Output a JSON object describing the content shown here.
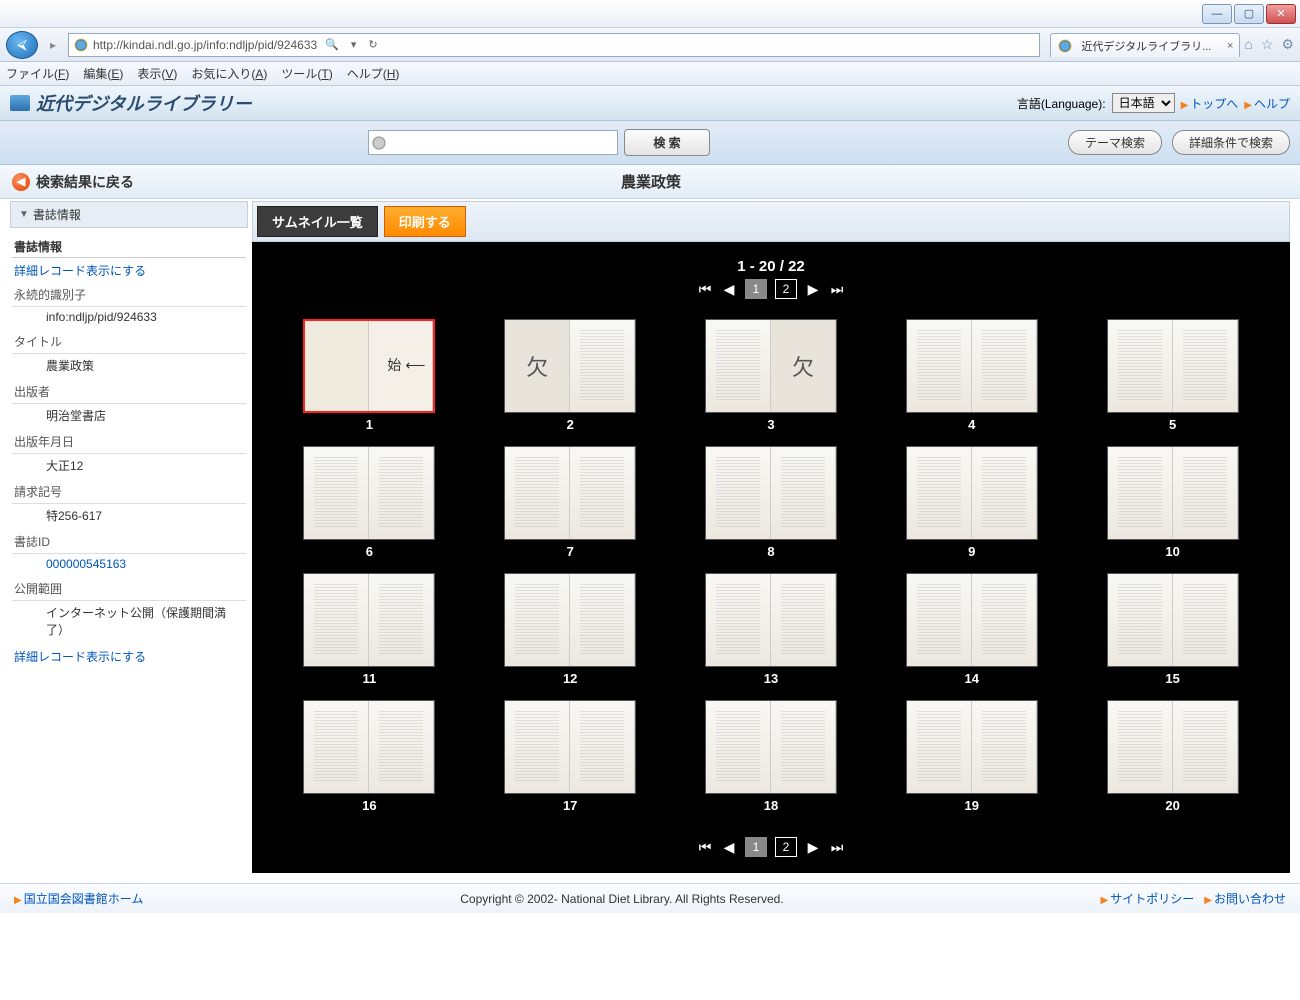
{
  "ie": {
    "url": "http://kindai.ndl.go.jp/info:ndljp/pid/924633",
    "search_hint": "",
    "tab_title": "近代デジタルライブラリ...",
    "menu": [
      "ファイル(<u>F</u>)",
      "編集(<u>E</u>)",
      "表示(<u>V</u>)",
      "お気に入り(<u>A</u>)",
      "ツール(<u>T</u>)",
      "ヘルプ(<u>H</u>)"
    ]
  },
  "header": {
    "title": "近代デジタルライブラリー",
    "language_label": "言語(Language):",
    "language_value": "日本語",
    "top_link": "トップへ",
    "help_link": "ヘルプ"
  },
  "search": {
    "button": "検 索",
    "theme": "テーマ検索",
    "advanced": "詳細条件で検索"
  },
  "page": {
    "back": "検索結果に戻る",
    "doc_title": "農業政策",
    "tab_thumbnail": "サムネイル一覧",
    "tab_print": "印刷する"
  },
  "pager": {
    "range": "1 - 20 / 22",
    "pages": [
      "1",
      "2"
    ],
    "active": "1"
  },
  "sidebar": {
    "section": "書誌情報",
    "heading": "書誌情報",
    "detail_link": "詳細レコード表示にする",
    "fields": [
      {
        "label": "永続的識別子",
        "value": "info:ndljp/pid/924633",
        "link": false
      },
      {
        "label": "タイトル",
        "value": "農業政策",
        "link": false
      },
      {
        "label": "出版者",
        "value": "明治堂書店",
        "link": false
      },
      {
        "label": "出版年月日",
        "value": "大正12",
        "link": false
      },
      {
        "label": "請求記号",
        "value": "特256-617",
        "link": false
      },
      {
        "label": "書誌ID",
        "value": "000000545163",
        "link": true
      },
      {
        "label": "公開範囲",
        "value": "インターネット公開（保護期間満了）",
        "link": false
      }
    ]
  },
  "thumbs": {
    "start_label": "始",
    "missing_label": "欠",
    "items": [
      {
        "n": "1",
        "sel": true,
        "start": true,
        "type": "cover"
      },
      {
        "n": "2",
        "missing_left": true
      },
      {
        "n": "3",
        "missing_right": true
      },
      {
        "n": "4"
      },
      {
        "n": "5"
      },
      {
        "n": "6"
      },
      {
        "n": "7"
      },
      {
        "n": "8"
      },
      {
        "n": "9"
      },
      {
        "n": "10"
      },
      {
        "n": "11"
      },
      {
        "n": "12"
      },
      {
        "n": "13"
      },
      {
        "n": "14"
      },
      {
        "n": "15"
      },
      {
        "n": "16"
      },
      {
        "n": "17"
      },
      {
        "n": "18"
      },
      {
        "n": "19"
      },
      {
        "n": "20"
      }
    ]
  },
  "footer": {
    "home": "国立国会図書館ホーム",
    "copyright": "Copyright © 2002- National Diet Library. All Rights Reserved.",
    "policy": "サイトポリシー",
    "contact": "お問い合わせ"
  }
}
